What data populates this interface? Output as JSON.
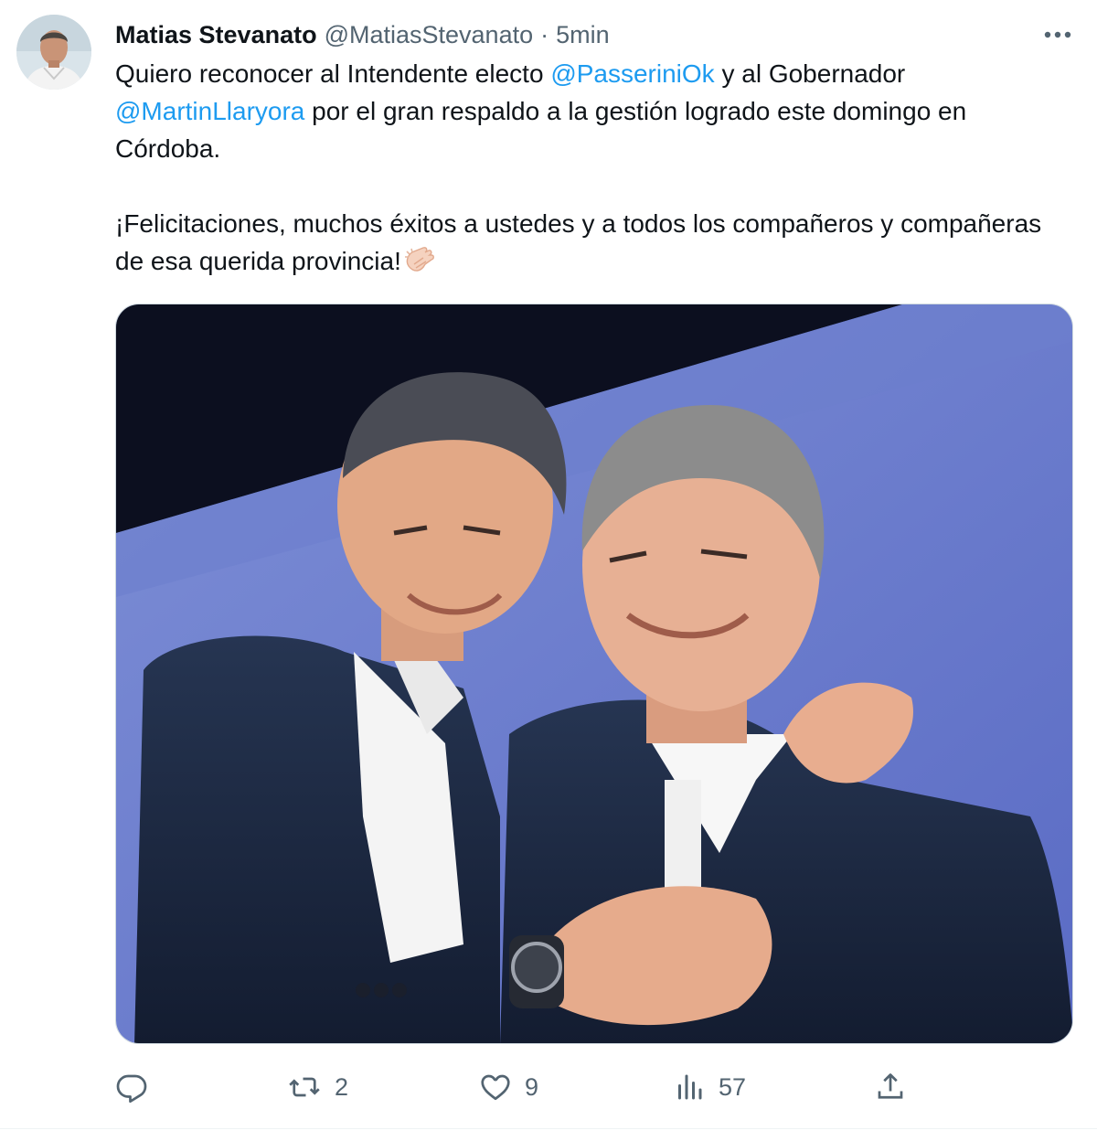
{
  "author": {
    "name": "Matias Stevanato",
    "handle": "@MatiasStevanato",
    "separator": "·",
    "time": "5min"
  },
  "tweet": {
    "p1_a": "Quiero reconocer al Intendente electo ",
    "mention_1": "@PasseriniOk",
    "p1_b": " y al Gobernador ",
    "mention_2": "@MartinLlaryora",
    "p1_c": " por el gran respaldo a la gestión logrado este domingo en Córdoba.",
    "p2": "¡Felicitaciones, muchos éxitos a ustedes y a todos los compañeros y compañeras de esa querida provincia!"
  },
  "icons": {
    "more": "more-icon",
    "emoji": "clapping-hands-icon",
    "reply": "reply-icon",
    "retweet": "retweet-icon",
    "like": "like-icon",
    "views": "views-icon",
    "share": "share-icon"
  },
  "actions": {
    "reply_count": "",
    "retweet_count": "2",
    "like_count": "9",
    "views_count": "57"
  },
  "colors": {
    "text": "#0f1419",
    "secondary": "#536471",
    "link": "#1d9bf0"
  }
}
